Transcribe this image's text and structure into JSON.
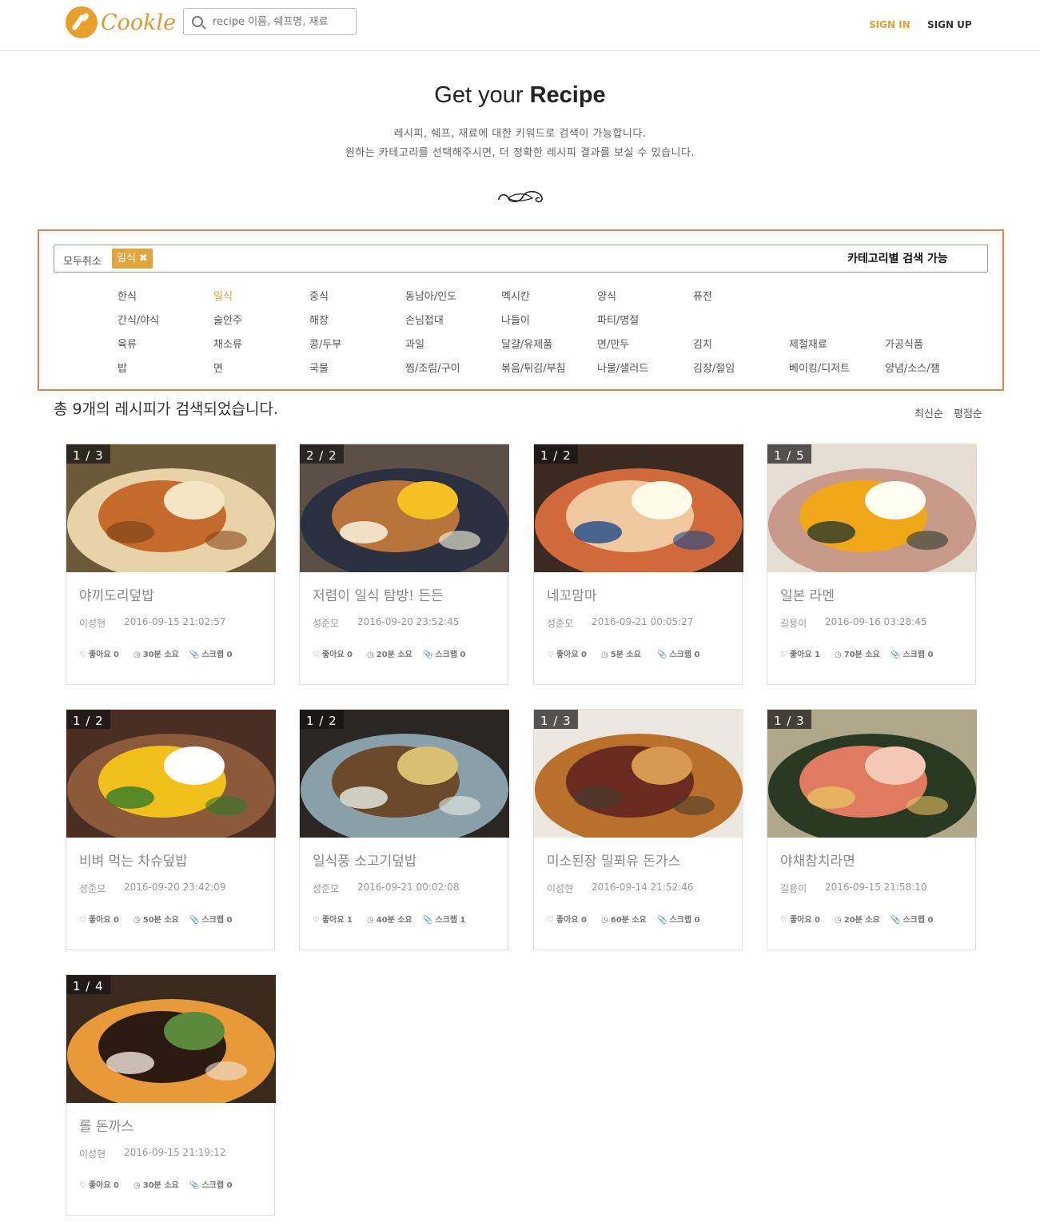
{
  "header": {
    "logo_text": "Cookle",
    "search_placeholder": "recipe 이름, 쉐프명, 재료",
    "sign_in": "SIGN IN",
    "sign_up": "SIGN UP"
  },
  "hero": {
    "title_prefix": "Get your",
    "title_bold": "Recipe",
    "line1": "레시피, 쉐프, 재료에 대한 키워드로 검색이 가능합니다.",
    "line2": "원하는 카테고리를 선택해주시면, 더 정확한 레시피 결과를 보실 수 있습니다."
  },
  "filter": {
    "clear_all": "모두취소",
    "selected_chip": "일식",
    "hint": "카테고리별 검색 가능",
    "rows": [
      [
        "한식",
        "일식",
        "중식",
        "동남아/인도",
        "멕시칸",
        "양식",
        "퓨전"
      ],
      [
        "간식/야식",
        "술안주",
        "해장",
        "손님접대",
        "나들이",
        "파티/명절"
      ],
      [
        "육류",
        "채소류",
        "콩/두부",
        "과일",
        "달걀/유제품",
        "면/만두",
        "김치",
        "제철재료",
        "가공식품"
      ],
      [
        "밥",
        "면",
        "국물",
        "찜/조림/구이",
        "볶음/튀김/부침",
        "나물/샐러드",
        "김장/절임",
        "베이킹/디저트",
        "양념/소스/잼"
      ]
    ],
    "active": "일식",
    "accent_color": "#e6a02b",
    "box_border_color": "#ef7b4b"
  },
  "results": {
    "count_text": "총 9개의 레시피가 검색되었습니다.",
    "sort_latest": "최신순",
    "sort_rating": "평점순"
  },
  "recipes": [
    {
      "counter": "1 / 3",
      "title": "야끼도리덮밥",
      "author": "이성현",
      "date": "2016-09-15 21:02:57",
      "likes": "좋아요 0",
      "time": "30분 소요",
      "scraps": "스크랩 0",
      "image": "grilled-chicken-bowl"
    },
    {
      "counter": "2 / 2",
      "title": "저렴이 일식 탐방! 든든",
      "author": "성준모",
      "date": "2016-09-20 23:52:45",
      "likes": "좋아요 0",
      "time": "20분 소요",
      "scraps": "스크랩 0",
      "image": "pork-egg-rice-bowl"
    },
    {
      "counter": "1 / 2",
      "title": "네꼬맘마",
      "author": "성준모",
      "date": "2016-09-21 00:05:27",
      "likes": "좋아요 0",
      "time": "5분 소요",
      "scraps": "스크랩 0",
      "image": "bonito-rice-bowl"
    },
    {
      "counter": "1 / 5",
      "title": "일본 라멘",
      "author": "길용이",
      "date": "2016-09-16 03:28:45",
      "likes": "좋아요 1",
      "time": "70분 소요",
      "scraps": "스크랩 0",
      "image": "ramen"
    },
    {
      "counter": "1 / 2",
      "title": "비벼 먹는 차슈덮밥",
      "author": "성준모",
      "date": "2016-09-20 23:42:09",
      "likes": "좋아요 0",
      "time": "50분 소요",
      "scraps": "스크랩 0",
      "image": "chashu-rice-bowl"
    },
    {
      "counter": "1 / 2",
      "title": "일식풍 소고기덮밥",
      "author": "성준모",
      "date": "2016-09-21 00:02:08",
      "likes": "좋아요 1",
      "time": "40분 소요",
      "scraps": "스크랩 1",
      "image": "beef-rice-bowl"
    },
    {
      "counter": "1 / 3",
      "title": "미소된장 밀푀유 돈가스",
      "author": "이성현",
      "date": "2016-09-14 21:52:46",
      "likes": "좋아요 0",
      "time": "60분 소요",
      "scraps": "스크랩 0",
      "image": "mille-feuille-katsu"
    },
    {
      "counter": "1 / 3",
      "title": "야채참치라면",
      "author": "길용이",
      "date": "2016-09-15 21:58:10",
      "likes": "좋아요 0",
      "time": "20분 소요",
      "scraps": "스크랩 0",
      "image": "tuna-ramen"
    },
    {
      "counter": "1 / 4",
      "title": "롤 돈까스",
      "author": "이성현",
      "date": "2016-09-15 21:19:12",
      "likes": "좋아요 0",
      "time": "30분 소요",
      "scraps": "스크랩 0",
      "image": "roll-katsu"
    }
  ]
}
